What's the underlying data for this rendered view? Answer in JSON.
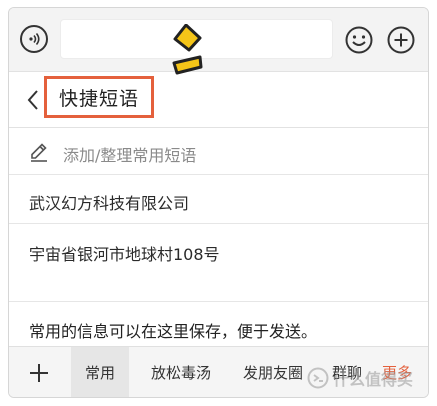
{
  "topbar": {
    "input_value": "",
    "icons": {
      "voice": "voice-icon",
      "emoji": "smiley-icon",
      "plus": "plus-circle-icon"
    }
  },
  "header": {
    "title": "快捷短语"
  },
  "add_phrase": {
    "label": "添加/整理常用短语",
    "icon": "pencil-icon"
  },
  "phrases": [
    "武汉幻方科技有限公司",
    "宇宙省银河市地球村108号"
  ],
  "info_text": "常用的信息可以在这里保存，便于发送。",
  "tabs": [
    {
      "label": "常用",
      "active": true
    },
    {
      "label": "放松毒汤",
      "active": false
    },
    {
      "label": "发朋友圈",
      "active": false
    },
    {
      "label": "群聊",
      "active": false
    },
    {
      "label": "更多",
      "active": false
    }
  ],
  "watermark": {
    "text": "什么值得买"
  },
  "colors": {
    "accent": "#e4603c",
    "logo": "#f5c518"
  }
}
